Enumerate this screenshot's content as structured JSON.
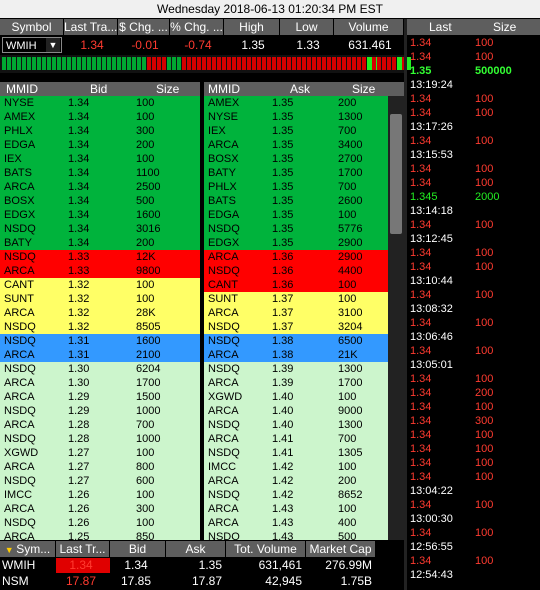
{
  "window": {
    "title": "Wednesday 2018-06-13 01:20:34 PM EST"
  },
  "quote_header": {
    "columns": [
      "Symbol",
      "Last Tra...",
      "$ Chg. ...",
      "% Chg. ...",
      "High",
      "Low",
      "Volume"
    ],
    "row": {
      "symbol": "WMIH",
      "last": "1.34",
      "chg": "-0.01",
      "pct_chg": "-0.74",
      "high": "1.35",
      "low": "1.33",
      "volume": "631.461"
    },
    "colors": {
      "down": "#ff3b30",
      "text": "#ffffff"
    }
  },
  "tick_bars": [
    "g",
    "g",
    "g",
    "g",
    "g",
    "g",
    "g",
    "g",
    "g",
    "g",
    "g",
    "g",
    "g",
    "g",
    "g",
    "g",
    "g",
    "g",
    "g",
    "g",
    "g",
    "g",
    "g",
    "g",
    "g",
    "g",
    "g",
    "g",
    "g",
    "r",
    "r",
    "r",
    "r",
    "g",
    "g",
    "g",
    "r",
    "r",
    "r",
    "r",
    "r",
    "r",
    "r",
    "r",
    "r",
    "r",
    "r",
    "r",
    "r",
    "r",
    "r",
    "r",
    "r",
    "r",
    "r",
    "r",
    "r",
    "r",
    "r",
    "r",
    "r",
    "r",
    "r",
    "r",
    "r",
    "r",
    "r",
    "r",
    "r",
    "r",
    "r",
    "r",
    "r",
    "G",
    "r",
    "r",
    "r",
    "r",
    "r",
    "G",
    "r"
  ],
  "bid_book": {
    "headers": [
      "MMID",
      "Bid",
      "Size"
    ],
    "rows": [
      {
        "mmid": "NYSE",
        "price": "1.34",
        "size": "100",
        "level": "g"
      },
      {
        "mmid": "AMEX",
        "price": "1.34",
        "size": "100",
        "level": "g"
      },
      {
        "mmid": "PHLX",
        "price": "1.34",
        "size": "300",
        "level": "g"
      },
      {
        "mmid": "EDGA",
        "price": "1.34",
        "size": "200",
        "level": "g"
      },
      {
        "mmid": "IEX",
        "price": "1.34",
        "size": "100",
        "level": "g"
      },
      {
        "mmid": "BATS",
        "price": "1.34",
        "size": "1100",
        "level": "g"
      },
      {
        "mmid": "ARCA",
        "price": "1.34",
        "size": "2500",
        "level": "g"
      },
      {
        "mmid": "BOSX",
        "price": "1.34",
        "size": "500",
        "level": "g"
      },
      {
        "mmid": "EDGX",
        "price": "1.34",
        "size": "1600",
        "level": "g"
      },
      {
        "mmid": "NSDQ",
        "price": "1.34",
        "size": "3016",
        "level": "g"
      },
      {
        "mmid": "BATY",
        "price": "1.34",
        "size": "200",
        "level": "g"
      },
      {
        "mmid": "NSDQ",
        "price": "1.33",
        "size": "12K",
        "level": "r"
      },
      {
        "mmid": "ARCA",
        "price": "1.33",
        "size": "9800",
        "level": "r"
      },
      {
        "mmid": "CANT",
        "price": "1.32",
        "size": "100",
        "level": "y"
      },
      {
        "mmid": "SUNT",
        "price": "1.32",
        "size": "100",
        "level": "y"
      },
      {
        "mmid": "ARCA",
        "price": "1.32",
        "size": "28K",
        "level": "y"
      },
      {
        "mmid": "NSDQ",
        "price": "1.32",
        "size": "8505",
        "level": "y"
      },
      {
        "mmid": "NSDQ",
        "price": "1.31",
        "size": "1600",
        "level": "b"
      },
      {
        "mmid": "ARCA",
        "price": "1.31",
        "size": "2100",
        "level": "b"
      },
      {
        "mmid": "NSDQ",
        "price": "1.30",
        "size": "6204",
        "level": "l"
      },
      {
        "mmid": "ARCA",
        "price": "1.30",
        "size": "1700",
        "level": "l"
      },
      {
        "mmid": "ARCA",
        "price": "1.29",
        "size": "1500",
        "level": "l"
      },
      {
        "mmid": "NSDQ",
        "price": "1.29",
        "size": "1000",
        "level": "l"
      },
      {
        "mmid": "ARCA",
        "price": "1.28",
        "size": "700",
        "level": "l"
      },
      {
        "mmid": "NSDQ",
        "price": "1.28",
        "size": "1000",
        "level": "l"
      },
      {
        "mmid": "XGWD",
        "price": "1.27",
        "size": "100",
        "level": "l"
      },
      {
        "mmid": "ARCA",
        "price": "1.27",
        "size": "800",
        "level": "l"
      },
      {
        "mmid": "NSDQ",
        "price": "1.27",
        "size": "600",
        "level": "l"
      },
      {
        "mmid": "IMCC",
        "price": "1.26",
        "size": "100",
        "level": "l"
      },
      {
        "mmid": "ARCA",
        "price": "1.26",
        "size": "300",
        "level": "l"
      },
      {
        "mmid": "NSDQ",
        "price": "1.26",
        "size": "100",
        "level": "l"
      },
      {
        "mmid": "ARCA",
        "price": "1.25",
        "size": "850",
        "level": "l"
      }
    ]
  },
  "ask_book": {
    "headers": [
      "MMID",
      "Ask",
      "Size"
    ],
    "rows": [
      {
        "mmid": "AMEX",
        "price": "1.35",
        "size": "200",
        "level": "g"
      },
      {
        "mmid": "NYSE",
        "price": "1.35",
        "size": "1300",
        "level": "g"
      },
      {
        "mmid": "IEX",
        "price": "1.35",
        "size": "700",
        "level": "g"
      },
      {
        "mmid": "ARCA",
        "price": "1.35",
        "size": "3400",
        "level": "g"
      },
      {
        "mmid": "BOSX",
        "price": "1.35",
        "size": "2700",
        "level": "g"
      },
      {
        "mmid": "BATY",
        "price": "1.35",
        "size": "1700",
        "level": "g"
      },
      {
        "mmid": "PHLX",
        "price": "1.35",
        "size": "700",
        "level": "g"
      },
      {
        "mmid": "BATS",
        "price": "1.35",
        "size": "2600",
        "level": "g"
      },
      {
        "mmid": "EDGA",
        "price": "1.35",
        "size": "100",
        "level": "g"
      },
      {
        "mmid": "NSDQ",
        "price": "1.35",
        "size": "5776",
        "level": "g"
      },
      {
        "mmid": "EDGX",
        "price": "1.35",
        "size": "2900",
        "level": "g"
      },
      {
        "mmid": "ARCA",
        "price": "1.36",
        "size": "2900",
        "level": "r"
      },
      {
        "mmid": "NSDQ",
        "price": "1.36",
        "size": "4400",
        "level": "r"
      },
      {
        "mmid": "CANT",
        "price": "1.36",
        "size": "100",
        "level": "r"
      },
      {
        "mmid": "SUNT",
        "price": "1.37",
        "size": "100",
        "level": "y"
      },
      {
        "mmid": "ARCA",
        "price": "1.37",
        "size": "3100",
        "level": "y"
      },
      {
        "mmid": "NSDQ",
        "price": "1.37",
        "size": "3204",
        "level": "y"
      },
      {
        "mmid": "NSDQ",
        "price": "1.38",
        "size": "6500",
        "level": "b"
      },
      {
        "mmid": "ARCA",
        "price": "1.38",
        "size": "21K",
        "level": "b"
      },
      {
        "mmid": "NSDQ",
        "price": "1.39",
        "size": "1300",
        "level": "l"
      },
      {
        "mmid": "ARCA",
        "price": "1.39",
        "size": "1700",
        "level": "l"
      },
      {
        "mmid": "XGWD",
        "price": "1.40",
        "size": "100",
        "level": "l"
      },
      {
        "mmid": "ARCA",
        "price": "1.40",
        "size": "9000",
        "level": "l"
      },
      {
        "mmid": "NSDQ",
        "price": "1.40",
        "size": "1300",
        "level": "l"
      },
      {
        "mmid": "ARCA",
        "price": "1.41",
        "size": "700",
        "level": "l"
      },
      {
        "mmid": "NSDQ",
        "price": "1.41",
        "size": "1305",
        "level": "l"
      },
      {
        "mmid": "IMCC",
        "price": "1.42",
        "size": "100",
        "level": "l"
      },
      {
        "mmid": "ARCA",
        "price": "1.42",
        "size": "200",
        "level": "l"
      },
      {
        "mmid": "NSDQ",
        "price": "1.42",
        "size": "8652",
        "level": "l"
      },
      {
        "mmid": "ARCA",
        "price": "1.43",
        "size": "100",
        "level": "l"
      },
      {
        "mmid": "ARCA",
        "price": "1.43",
        "size": "400",
        "level": "l"
      },
      {
        "mmid": "NSDQ",
        "price": "1.43",
        "size": "500",
        "level": "l"
      }
    ]
  },
  "level_colors": {
    "g": "#00b33c",
    "r": "#ff0000",
    "y": "#ffff66",
    "b": "#3399ff",
    "l": "#ccf5cc"
  },
  "time_sales": {
    "headers": [
      "Last",
      "Size"
    ],
    "rows": [
      {
        "t": "p",
        "price": "1.34",
        "size": "100",
        "c": "r"
      },
      {
        "t": "p",
        "price": "1.34",
        "size": "100",
        "c": "r"
      },
      {
        "t": "p",
        "price": "1.35",
        "size": "500000",
        "c": "G"
      },
      {
        "t": "time",
        "text": "13:19:24"
      },
      {
        "t": "p",
        "price": "1.34",
        "size": "100",
        "c": "r"
      },
      {
        "t": "p",
        "price": "1.34",
        "size": "100",
        "c": "r"
      },
      {
        "t": "time",
        "text": "13:17:26"
      },
      {
        "t": "p",
        "price": "1.34",
        "size": "100",
        "c": "r"
      },
      {
        "t": "time",
        "text": "13:15:53"
      },
      {
        "t": "p",
        "price": "1.34",
        "size": "100",
        "c": "r"
      },
      {
        "t": "p",
        "price": "1.34",
        "size": "100",
        "c": "r"
      },
      {
        "t": "p",
        "price": "1.345",
        "size": "2000",
        "c": "g"
      },
      {
        "t": "time",
        "text": "13:14:18"
      },
      {
        "t": "p",
        "price": "1.34",
        "size": "100",
        "c": "r"
      },
      {
        "t": "time",
        "text": "13:12:45"
      },
      {
        "t": "p",
        "price": "1.34",
        "size": "100",
        "c": "r"
      },
      {
        "t": "p",
        "price": "1.34",
        "size": "100",
        "c": "r"
      },
      {
        "t": "time",
        "text": "13:10:44"
      },
      {
        "t": "p",
        "price": "1.34",
        "size": "100",
        "c": "r"
      },
      {
        "t": "time",
        "text": "13:08:32"
      },
      {
        "t": "p",
        "price": "1.34",
        "size": "100",
        "c": "r"
      },
      {
        "t": "time",
        "text": "13:06:46"
      },
      {
        "t": "p",
        "price": "1.34",
        "size": "100",
        "c": "r"
      },
      {
        "t": "time",
        "text": "13:05:01"
      },
      {
        "t": "p",
        "price": "1.34",
        "size": "100",
        "c": "r"
      },
      {
        "t": "p",
        "price": "1.34",
        "size": "200",
        "c": "r"
      },
      {
        "t": "p",
        "price": "1.34",
        "size": "100",
        "c": "r"
      },
      {
        "t": "p",
        "price": "1.34",
        "size": "300",
        "c": "r"
      },
      {
        "t": "p",
        "price": "1.34",
        "size": "100",
        "c": "r"
      },
      {
        "t": "p",
        "price": "1.34",
        "size": "100",
        "c": "r"
      },
      {
        "t": "p",
        "price": "1.34",
        "size": "100",
        "c": "r"
      },
      {
        "t": "p",
        "price": "1.34",
        "size": "100",
        "c": "r"
      },
      {
        "t": "time",
        "text": "13:04:22"
      },
      {
        "t": "p",
        "price": "1.34",
        "size": "100",
        "c": "r"
      },
      {
        "t": "time",
        "text": "13:00:30"
      },
      {
        "t": "p",
        "price": "1.34",
        "size": "100",
        "c": "r"
      },
      {
        "t": "time",
        "text": "12:56:55"
      },
      {
        "t": "p",
        "price": "1.34",
        "size": "100",
        "c": "r"
      },
      {
        "t": "time",
        "text": "12:54:43"
      }
    ]
  },
  "watchlist": {
    "headers": [
      "Sym...",
      "Last Tr...",
      "Bid",
      "Ask",
      "Tot. Volume",
      "Market Cap"
    ],
    "rows": [
      {
        "sym": "WMIH",
        "last": "1.34",
        "bid": "1.34",
        "ask": "1.35",
        "vol": "631,461",
        "cap": "276.99M"
      },
      {
        "sym": "NSM",
        "last": "17.87",
        "bid": "17.85",
        "ask": "17.87",
        "vol": "42,945",
        "cap": "1.75B"
      }
    ]
  }
}
